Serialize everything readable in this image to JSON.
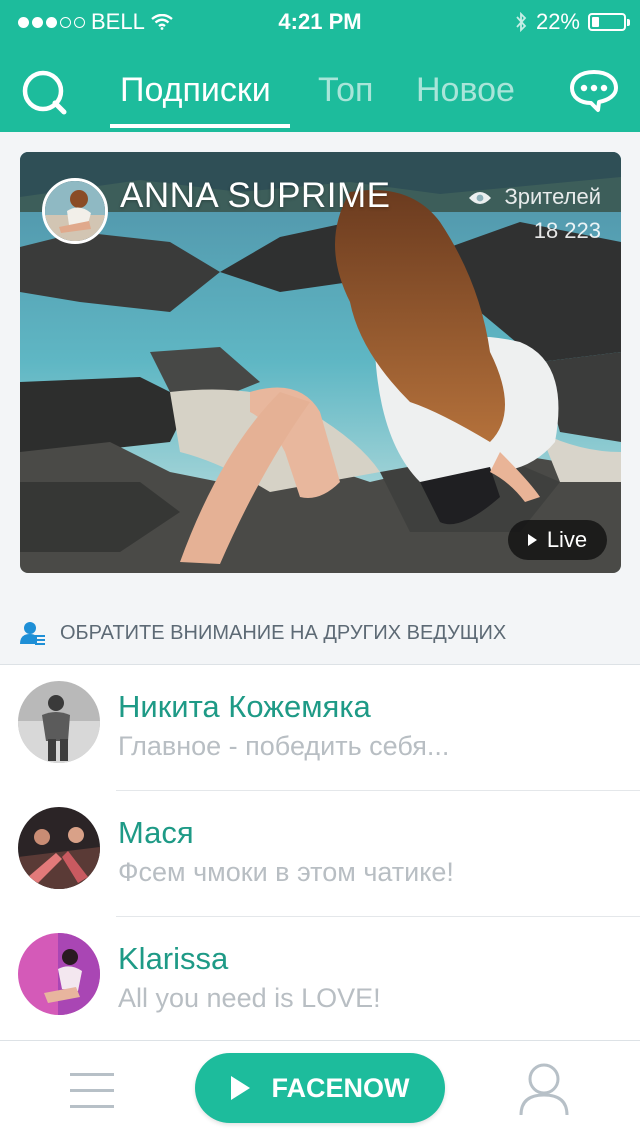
{
  "status_bar": {
    "carrier": "BELL",
    "time": "4:21 PM",
    "battery_text": "22%",
    "battery_level": 0.22,
    "signal_bars_filled": 3,
    "signal_bars_total": 5
  },
  "nav": {
    "tabs": [
      {
        "label": "Подписки",
        "active": true
      },
      {
        "label": "Топ",
        "active": false
      },
      {
        "label": "Новое",
        "active": false
      }
    ],
    "search_icon": "search-icon",
    "chat_icon": "chat-bubble-icon"
  },
  "featured": {
    "streamer_name": "ANNA SUPRIME",
    "viewers_label": "Зрителей",
    "viewers_count": "18 223",
    "live_label": "Live"
  },
  "section": {
    "title": "ОБРАТИТЕ ВНИМАНИЕ НА ДРУГИХ ВЕДУЩИХ",
    "icon": "user-list-icon"
  },
  "streamers": [
    {
      "name": "Никита Кожемяка",
      "status": "Главное - победить себя..."
    },
    {
      "name": "Мася",
      "status": "Фсем чмоки в этом чатике!"
    },
    {
      "name": "Klarissa",
      "status": "All you need is LOVE!"
    }
  ],
  "bottom_bar": {
    "cta_label": "FACENOW",
    "menu_icon": "menu-icon",
    "profile_icon": "profile-icon"
  },
  "colors": {
    "accent": "#1dbc9c",
    "name_text": "#1e9a86",
    "muted_text": "#b8bec3",
    "background": "#f3f5f7"
  }
}
